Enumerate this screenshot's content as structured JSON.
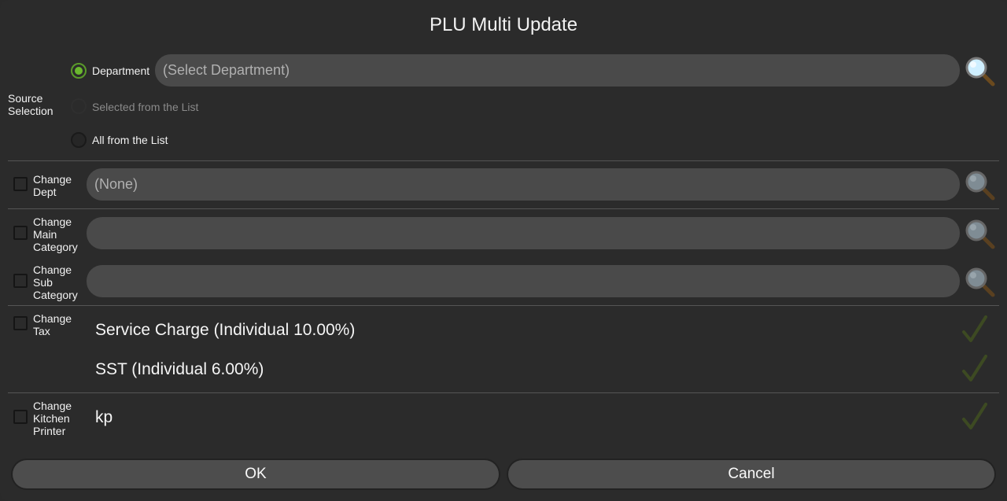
{
  "dialog": {
    "title": "PLU Multi Update"
  },
  "source_selection": {
    "label": "Source\nSelection",
    "options": [
      {
        "label": "Department",
        "checked": true,
        "enabled": true
      },
      {
        "label": "Selected from the List",
        "checked": false,
        "enabled": false
      },
      {
        "label": "All from the List",
        "checked": false,
        "enabled": true
      }
    ],
    "department_placeholder": "(Select Department)"
  },
  "change_dept": {
    "label": "Change\nDept",
    "value": "(None)"
  },
  "change_main_category": {
    "label": "Change\nMain\nCategory",
    "value": ""
  },
  "change_sub_category": {
    "label": "Change\nSub\nCategory",
    "value": ""
  },
  "change_tax": {
    "label": "Change\nTax",
    "items": [
      "Service Charge (Individual 10.00%)",
      "SST (Individual 6.00%)"
    ]
  },
  "change_kitchen_printer": {
    "label": "Change\nKitchen\nPrinter",
    "items": [
      "kp"
    ]
  },
  "buttons": {
    "ok": "OK",
    "cancel": "Cancel"
  },
  "icons": {
    "search": "magnifier-icon",
    "check": "checkmark-icon"
  },
  "colors": {
    "accent": "#6ab82e",
    "field_bg": "#4a4a4a",
    "check_dim": "#3d4a22"
  }
}
